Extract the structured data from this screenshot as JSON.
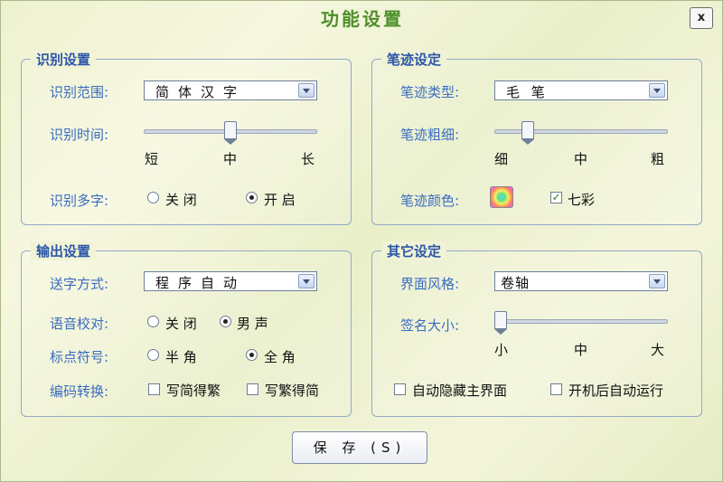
{
  "window": {
    "title": "功能设置",
    "close_label": "x"
  },
  "recognition": {
    "legend": "识别设置",
    "range_label": "识别范围:",
    "range_value": "简体汉字",
    "time_label": "识别时间:",
    "time_ticks": [
      "短",
      "中",
      "长"
    ],
    "time_level": 0.5,
    "multi_label": "识别多字:",
    "multi_off": "关 闭",
    "multi_on": "开 启",
    "multi_selected": "开 启"
  },
  "stroke": {
    "legend": "笔迹设定",
    "type_label": "笔迹类型:",
    "type_value": "毛    笔",
    "width_label": "笔迹粗细:",
    "width_ticks": [
      "细",
      "中",
      "粗"
    ],
    "width_level": 0.2,
    "color_label": "笔迹颜色:",
    "colorful_label": "七彩",
    "colorful_checked": true
  },
  "output": {
    "legend": "输出设置",
    "send_label": "送字方式:",
    "send_value": "程序自动",
    "voice_label": "语音校对:",
    "voice_off": "关 闭",
    "voice_male": "男 声",
    "voice_selected": "男 声",
    "punct_label": "标点符号:",
    "punct_half": "半 角",
    "punct_full": "全 角",
    "punct_selected": "全 角",
    "encoding_label": "编码转换:",
    "to_traditional": "写简得繁",
    "to_simplified": "写繁得简"
  },
  "other": {
    "legend": "其它设定",
    "style_label": "界面风格:",
    "style_value": "卷轴",
    "sign_label": "签名大小:",
    "sign_ticks": [
      "小",
      "中",
      "大"
    ],
    "sign_level": 0.0,
    "auto_hide": "自动隐藏主界面",
    "autostart": "开机后自动运行"
  },
  "footer": {
    "save_label": "保 存 (S)"
  }
}
